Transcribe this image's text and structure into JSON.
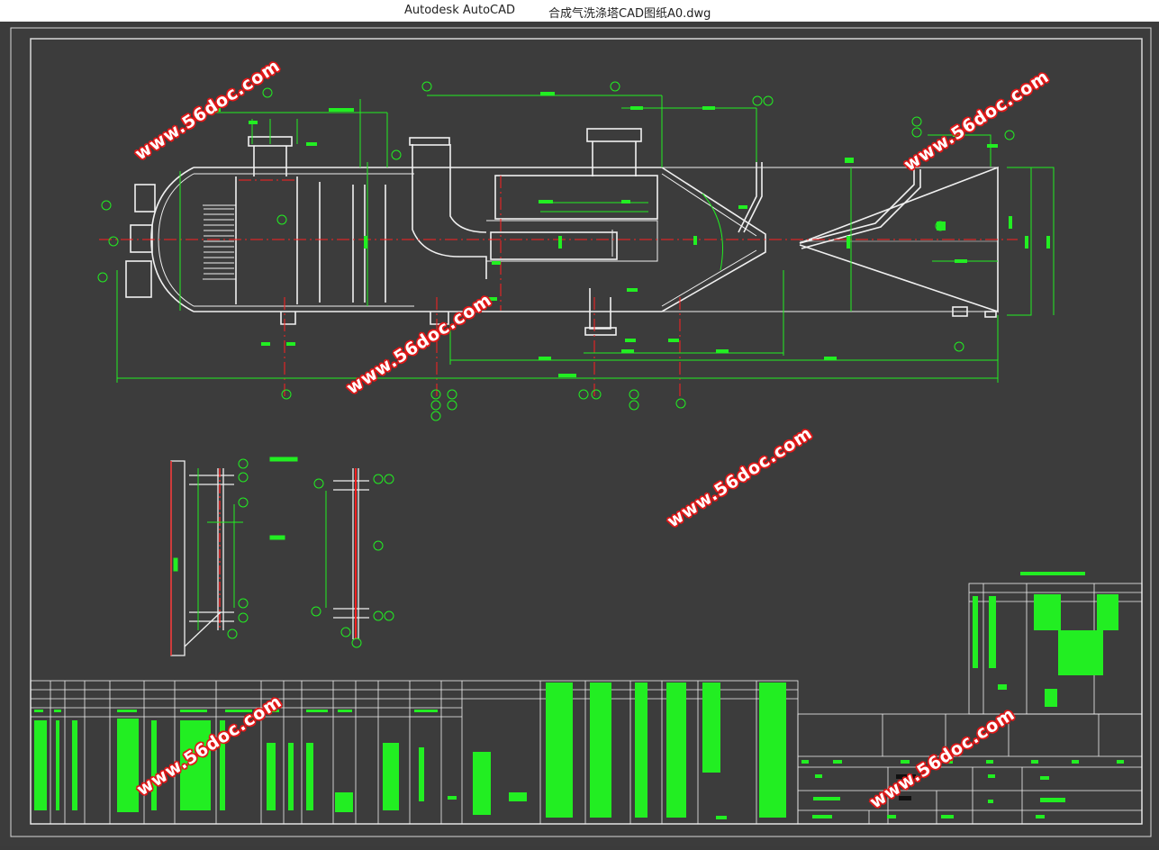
{
  "window": {
    "app_name": "Autodesk AutoCAD",
    "document_title": "合成气洗涤塔CAD图纸A0.dwg"
  },
  "watermark": {
    "text": "www.56doc.com",
    "color": "#e01818"
  },
  "drawing": {
    "background": "#3c3c3c",
    "line_color": "#ffffff",
    "dimension_color": "#22ee22",
    "centerline_color": "#ff2020",
    "icons": [
      "vessel-drawing",
      "level-gauge-detail",
      "parts-table",
      "title-block"
    ]
  }
}
